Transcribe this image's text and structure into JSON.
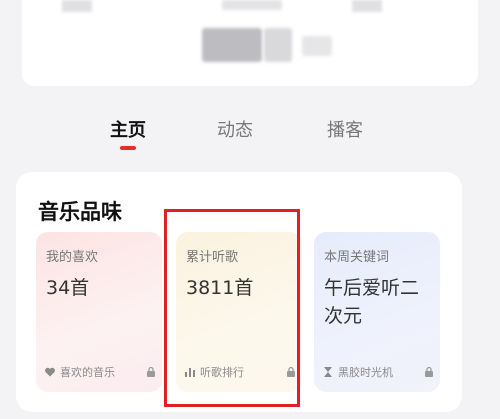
{
  "tabs": [
    {
      "label": "主页",
      "active": true
    },
    {
      "label": "动态",
      "active": false
    },
    {
      "label": "播客",
      "active": false
    }
  ],
  "accent_color": "#e52f2f",
  "highlight_color": "#e01f26",
  "music_taste": {
    "title": "音乐品味",
    "tiles": [
      {
        "label": "我的喜欢",
        "value": "34首",
        "footer": "喜欢的音乐",
        "icon": "heart-icon"
      },
      {
        "label": "累计听歌",
        "value": "3811首",
        "footer": "听歌排行",
        "icon": "bar-chart-icon"
      },
      {
        "label": "本周关键词",
        "value": "午后爱听二次元",
        "footer": "黑胶时光机",
        "icon": "hourglass-icon"
      }
    ]
  }
}
